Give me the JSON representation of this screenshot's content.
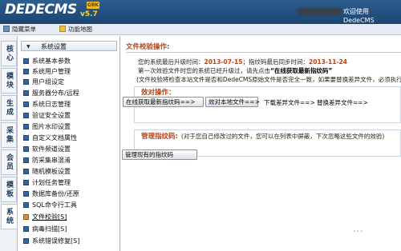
{
  "app": {
    "logo": "DEDECMS",
    "version": "v5.7",
    "badge": "GBK",
    "welcome": "欢迎使用 DedeCMS"
  },
  "toolbar": {
    "hide_menu": "隐藏菜单",
    "function_map": "功能地图"
  },
  "tabs": [
    "核心",
    "模块",
    "生成",
    "采集",
    "会员",
    "模板",
    "系统"
  ],
  "active_tab": "系统",
  "sidebar": {
    "header": "系统设置",
    "items": [
      "系统基本参数",
      "系统用户管理",
      "用户组设定",
      "服务器分布/远程",
      "系统日志管理",
      "验证安全设置",
      "图片水印设置",
      "自定义文档属性",
      "软件频道设置",
      "防采集串混淆",
      "随机模板设置",
      "计划任务管理",
      "数据库备份/还原",
      "SQL命令行工具",
      "文件校验[S]",
      "病毒扫描[S]",
      "系统错误修复[S]"
    ],
    "active_item": "文件校验[S]"
  },
  "main": {
    "title": "文件校验操作:",
    "info": {
      "line1_prefix": "您的系统最后升级时间：",
      "upgrade_date": "2013-07-15",
      "line1_mid": "；指纹码最后同步时间：",
      "sync_date": "2013-11-24",
      "line2_prefix": "第一次效验文件时您的系统已经升级过，请先点击",
      "line2_quote": "“在线获取最新指纹码”",
      "line3": "(文件校验将检查本站文件是否和DedeCMS原始文件是否完全一致，如果要替换差异文件，必须执行)"
    },
    "panel1": {
      "title": "效对操作：",
      "buttons": {
        "get_fingerprint": "在线获取最新指纹码==>",
        "check_local": "效对本地文件==>",
        "download_diff": "下载差异文件==>",
        "replace_diff": "替换差异文件==>"
      }
    },
    "panel2": {
      "title": "管理指纹码:",
      "tip": "(对于您自己修改过的文件，您可以在列表中屏蔽，下次忽略这些文件的效验)",
      "manage_button": "管理现有的指纹码"
    },
    "loading": "..."
  },
  "colors": {
    "header_bg": "#1b4570",
    "accent_title": "#b3441a",
    "date_red": "#c43c0c",
    "bullet_blue": "#2f66a6",
    "bullet_orange": "#e38a28"
  },
  "icons": {
    "hide_menu": "hide-menu-icon",
    "function_map": "function-map-icon",
    "sidebar_bullet": "menu-bullet-icon"
  }
}
